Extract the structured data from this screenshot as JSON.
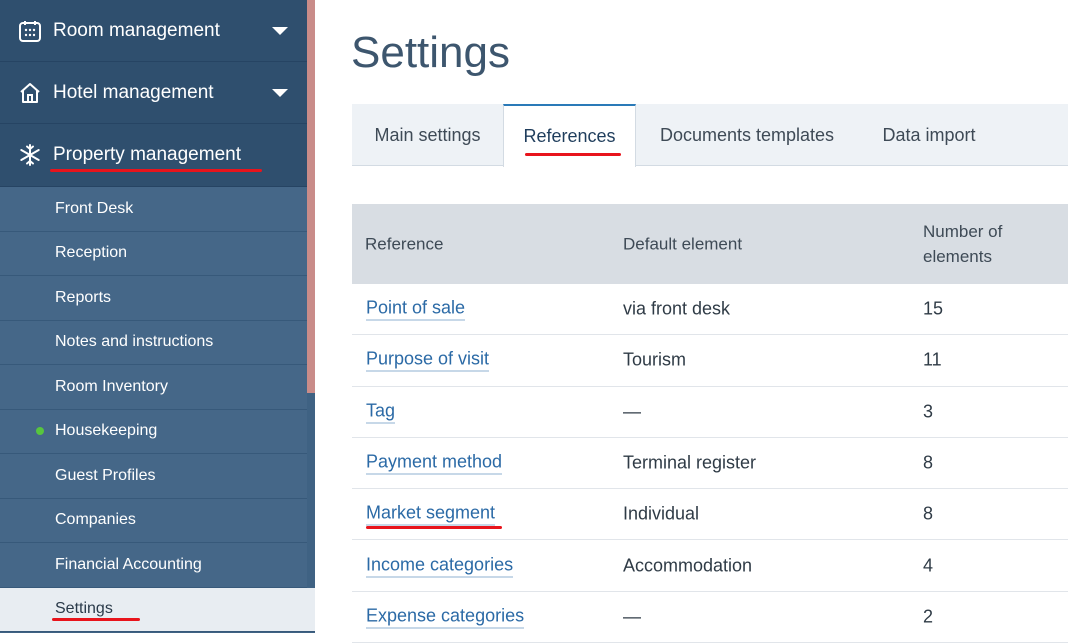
{
  "sidebar": {
    "sections": [
      {
        "label": "Room management",
        "icon": "calendar-icon",
        "expandable": true
      },
      {
        "label": "Hotel management",
        "icon": "house-icon",
        "expandable": true
      },
      {
        "label": "Property management",
        "icon": "snowflake-icon",
        "expandable": false
      }
    ],
    "items": [
      {
        "label": "Front Desk"
      },
      {
        "label": "Reception"
      },
      {
        "label": "Reports"
      },
      {
        "label": "Notes and instructions"
      },
      {
        "label": "Room Inventory"
      },
      {
        "label": "Housekeeping",
        "status_dot": "#57c53e"
      },
      {
        "label": "Guest Profiles"
      },
      {
        "label": "Companies"
      },
      {
        "label": "Financial Accounting"
      },
      {
        "label": "Settings",
        "active": true
      }
    ]
  },
  "page": {
    "title": "Settings"
  },
  "tabs": [
    {
      "label": "Main settings"
    },
    {
      "label": "References",
      "active": true
    },
    {
      "label": "Documents templates"
    },
    {
      "label": "Data import"
    }
  ],
  "table": {
    "headers": {
      "reference": "Reference",
      "default_element": "Default element",
      "number_line1": "Number of",
      "number_line2": "elements"
    },
    "rows": [
      {
        "reference": "Point of sale",
        "default": "via front desk",
        "count": "15"
      },
      {
        "reference": "Purpose of visit",
        "default": "Tourism",
        "count": "11"
      },
      {
        "reference": "Tag",
        "default": "—",
        "count": "3"
      },
      {
        "reference": "Payment method",
        "default": "Terminal register",
        "count": "8"
      },
      {
        "reference": "Market segment",
        "default": "Individual",
        "count": "8"
      },
      {
        "reference": "Income categories",
        "default": "Accommodation",
        "count": "4"
      },
      {
        "reference": "Expense categories",
        "default": "—",
        "count": "2"
      }
    ]
  },
  "colors": {
    "sidebar_bg": "#2f4f6e",
    "sub_bg": "#456788",
    "link": "#2b6aa6",
    "annotation_red": "#e8141c",
    "active_tab_border": "#2a7ab8"
  }
}
